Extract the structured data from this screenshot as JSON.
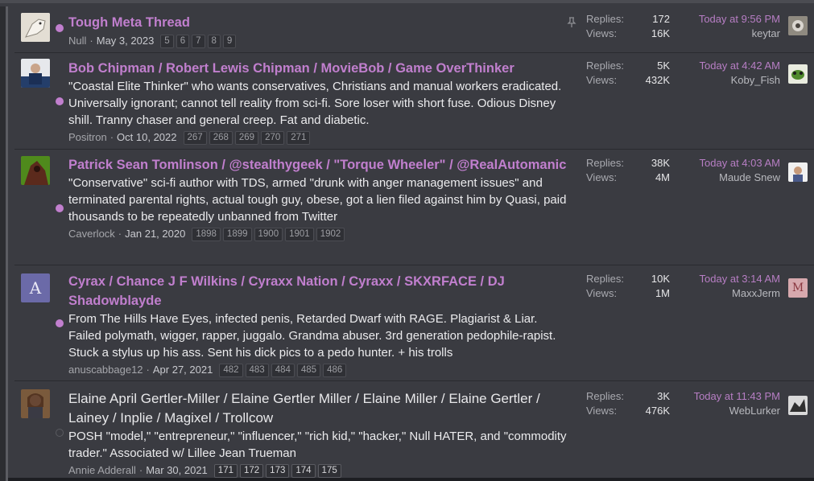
{
  "threads": [
    {
      "title": "Tough Meta Thread",
      "excerpt": "",
      "author": "Null",
      "date": "May 3, 2023",
      "pages": [
        "5",
        "6",
        "7",
        "8",
        "9"
      ],
      "pinned": true,
      "unread": true,
      "replies_label": "Replies:",
      "replies": "172",
      "views_label": "Views:",
      "views": "16K",
      "latest_time": "Today at 9:56 PM",
      "latest_user": "keytar"
    },
    {
      "title": "Bob Chipman / Robert Lewis Chipman / MovieBob / Game OverThinker",
      "excerpt": "\"Coastal Elite Thinker\" who wants conservatives, Christians and manual workers eradicated. Universally ignorant; cannot tell reality from sci-fi. Sore loser with short fuse. Odious Disney shill. Tranny chaser and general creep. Fat and diabetic.",
      "author": "Positron",
      "date": "Oct 10, 2022",
      "pages": [
        "267",
        "268",
        "269",
        "270",
        "271"
      ],
      "pinned": false,
      "unread": true,
      "replies_label": "Replies:",
      "replies": "5K",
      "views_label": "Views:",
      "views": "432K",
      "latest_time": "Today at 4:42 AM",
      "latest_user": "Koby_Fish"
    },
    {
      "title": "Patrick Sean Tomlinson / @stealthygeek / \"Torque Wheeler\" / @RealAutomanic",
      "excerpt": "\"Conservative\" sci-fi author with TDS, armed \"drunk with anger management issues\" and terminated parental rights, actual tough guy, obese, got a lien filed against him by Quasi, paid thousands to be repeatedly unbanned from Twitter",
      "author": "Caverlock",
      "date": "Jan 21, 2020",
      "pages": [
        "1898",
        "1899",
        "1900",
        "1901",
        "1902"
      ],
      "pinned": false,
      "unread": true,
      "replies_label": "Replies:",
      "replies": "38K",
      "views_label": "Views:",
      "views": "4M",
      "latest_time": "Today at 4:03 AM",
      "latest_user": "Maude Snew"
    },
    {
      "title": "Cyrax / Chance J F Wilkins / Cyraxx Nation / Cyraxx / SKXRFACE / DJ Shadowblayde",
      "excerpt": "From The Hills Have Eyes, infected penis, Retarded Dwarf with RAGE. Plagiarist & Liar. Failed polymath, wigger, rapper, juggalo. Grandma abuser. 3rd generation pedophile-rapist. Stuck a stylus up his ass. Sent his dick pics to a pedo hunter. + his trolls",
      "author": "anuscabbage12",
      "date": "Apr 27, 2021",
      "pages": [
        "482",
        "483",
        "484",
        "485",
        "486"
      ],
      "pinned": false,
      "unread": true,
      "avatar_letter": "A",
      "replies_label": "Replies:",
      "replies": "10K",
      "views_label": "Views:",
      "views": "1M",
      "latest_time": "Today at 3:14 AM",
      "latest_user": "MaxxJerm",
      "latest_avatar_letter": "M"
    },
    {
      "title": "Elaine April Gertler-Miller / Elaine Gertler Miller / Elaine Miller / Elaine Gertler / Lainey / Inplie / Magixel / Trollcow",
      "excerpt": "POSH \"model,\" \"entrepreneur,\" \"influencer,\" \"rich kid,\" \"hacker,\" Null HATER, and \"commodity trader.\" Associated w/ Lillee Jean Trueman",
      "author": "Annie Adderall",
      "date": "Mar 30, 2021",
      "pages": [
        "171",
        "172",
        "173",
        "174",
        "175"
      ],
      "pinned": false,
      "unread": false,
      "replies_label": "Replies:",
      "replies": "3K",
      "views_label": "Views:",
      "views": "476K",
      "latest_time": "Today at 11:43 PM",
      "latest_user": "WebLurker"
    }
  ],
  "colors": {
    "accent": "#c17fce",
    "background": "#3a3b41",
    "text": "#ebebed"
  }
}
